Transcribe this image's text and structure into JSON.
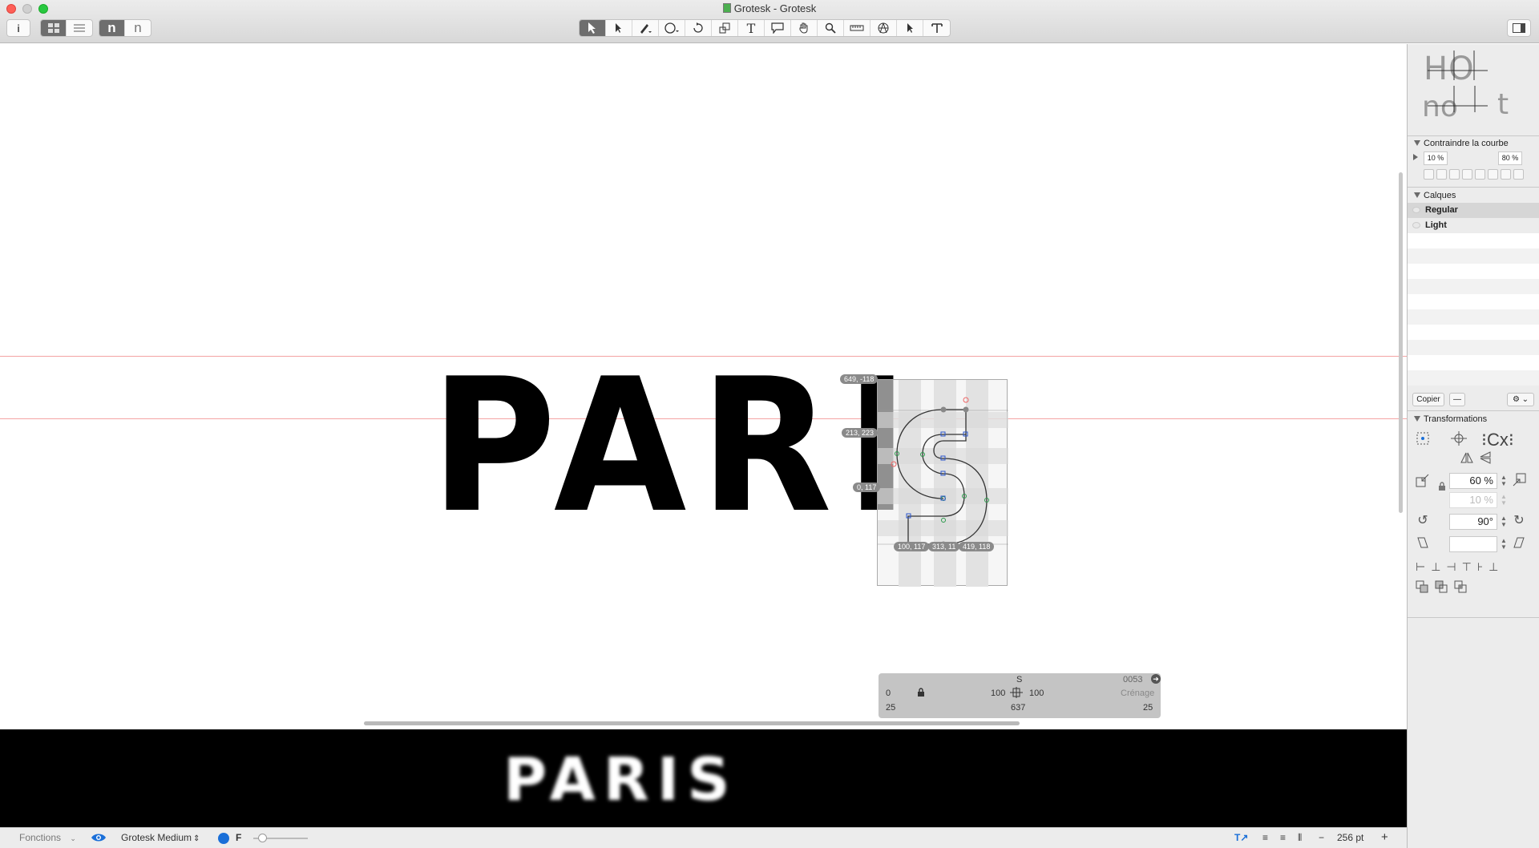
{
  "window": {
    "title": "Grotesk - Grotesk"
  },
  "toolbar": {
    "info_icon": "i",
    "view_modes": [
      "grid-icon",
      "list-icon"
    ],
    "glyph_buttons": [
      "n",
      "n"
    ],
    "tools": [
      "pointer-tool-icon",
      "pen-select-icon",
      "draw-pencil-icon",
      "ellipse-icon",
      "rotate-icon",
      "scale-icon",
      "text-tool-icon",
      "annotation-icon",
      "hand-icon",
      "zoom-icon",
      "measure-icon",
      "primitives-icon",
      "select-all-icon",
      "text-align-icon"
    ]
  },
  "canvas": {
    "text": "PARIS",
    "coords_left": [
      "649, -118",
      "213, 223",
      "0, 117"
    ],
    "coords_bottom": [
      "100, 117",
      "313, 11",
      "419, 118"
    ]
  },
  "info_panel": {
    "glyph_name": "S",
    "unicode": "0053",
    "left_kern": "0",
    "lsb": "100",
    "rsb": "100",
    "kerning_label": "Crénage",
    "row3_left": "25",
    "width": "637",
    "row3_right": "25"
  },
  "preview": {
    "text": "PARIS"
  },
  "bottombar": {
    "functions_label": "Fonctions",
    "font_name": "Grotesk Medium",
    "f_label": "F",
    "size": "256 pt",
    "minus": "−",
    "plus": "+"
  },
  "sidebar": {
    "palette_preview": [
      "HO",
      "no",
      "t"
    ],
    "constrain": {
      "title": "Contraindre la courbe",
      "min": "10 %",
      "max": "80 %"
    },
    "layers": {
      "title": "Calques",
      "items": [
        "Regular",
        "Light"
      ]
    },
    "copy_button": "Copier",
    "paste_button": "—",
    "transformations": {
      "title": "Transformations",
      "scale": "60 %",
      "scale_secondary": "10 %",
      "rotate": "90°",
      "slant": ""
    }
  }
}
